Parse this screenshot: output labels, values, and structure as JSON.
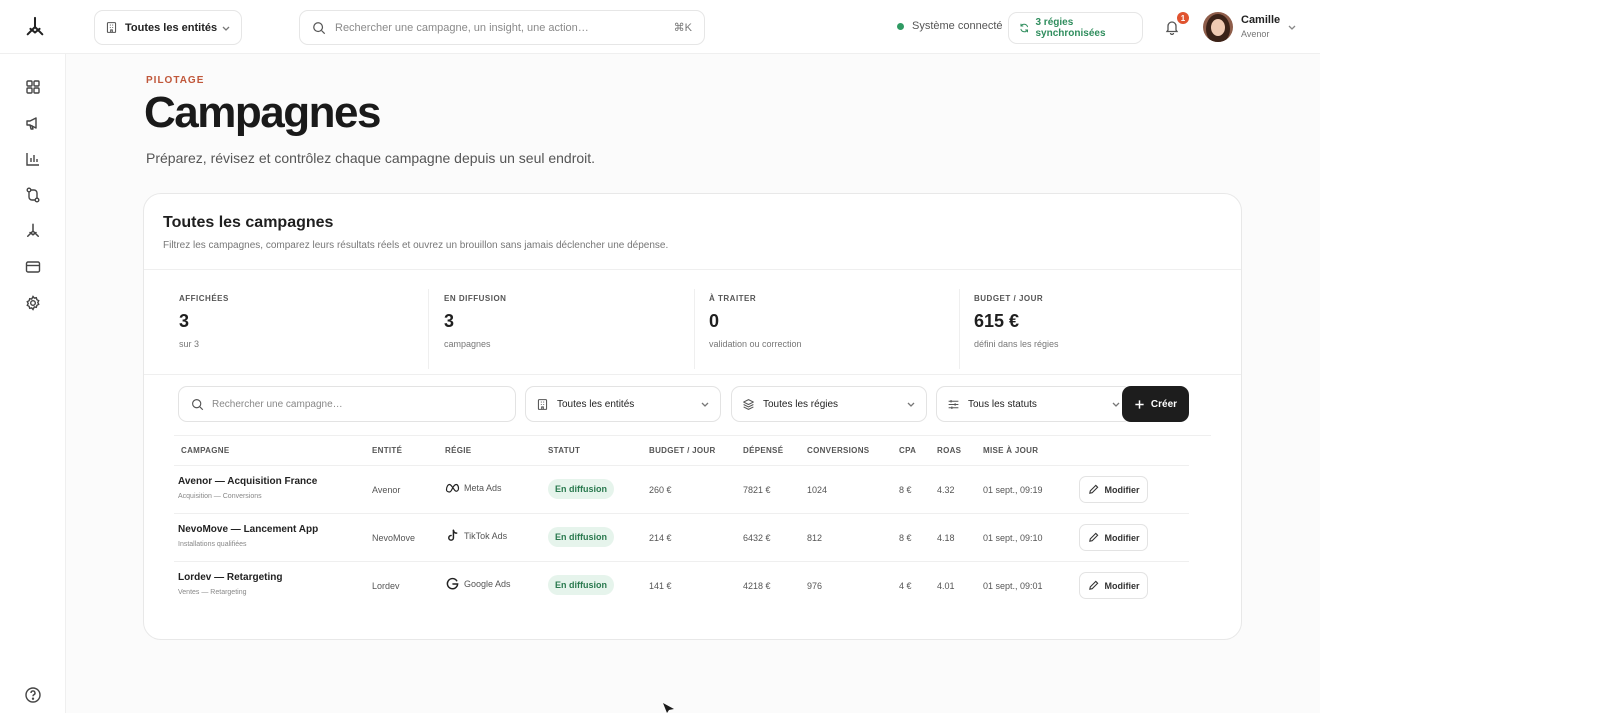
{
  "topbar": {
    "entity_select": "Toutes les entités",
    "search_placeholder": "Rechercher une campagne, un insight, une action…",
    "search_shortcut": "⌘K",
    "system_status": "Système connecté",
    "sync_label": "3 régies synchronisées",
    "notification_count": "1",
    "user_name": "Camille",
    "user_org": "Avenor"
  },
  "sidebar": {
    "icons": [
      "dashboard-icon",
      "megaphone-icon",
      "bar-chart-icon",
      "routes-icon",
      "brand-icon",
      "card-icon",
      "settings-icon"
    ],
    "help_icon": "help-icon"
  },
  "page": {
    "eyebrow": "PILOTAGE",
    "title": "Campagnes",
    "subtitle": "Préparez, révisez et contrôlez chaque campagne depuis un seul endroit."
  },
  "card": {
    "title": "Toutes les campagnes",
    "description": "Filtrez les campagnes, comparez leurs résultats réels et ouvrez un brouillon sans jamais déclencher une dépense.",
    "stats": [
      {
        "label": "AFFICHÉES",
        "value": "3",
        "note": "sur 3"
      },
      {
        "label": "EN DIFFUSION",
        "value": "3",
        "note": "campagnes"
      },
      {
        "label": "À TRAITER",
        "value": "0",
        "note": "validation ou correction"
      },
      {
        "label": "BUDGET / JOUR",
        "value": "615 €",
        "note": "défini dans les régies"
      }
    ],
    "filters": {
      "search_placeholder": "Rechercher une campagne…",
      "entity": "Toutes les entités",
      "regie": "Toutes les régies",
      "status": "Tous les statuts",
      "create_label": "Créer"
    },
    "table": {
      "headers": [
        "CAMPAGNE",
        "ENTITÉ",
        "RÉGIE",
        "STATUT",
        "BUDGET / JOUR",
        "DÉPENSÉ",
        "CONVERSIONS",
        "CPA",
        "ROAS",
        "MISE À JOUR"
      ],
      "rows": [
        {
          "name": "Avenor — Acquisition France",
          "sub": "Acquisition — Conversions",
          "entity": "Avenor",
          "regie": "Meta Ads",
          "regie_icon": "meta-icon",
          "status": "En diffusion",
          "budget": "260 €",
          "spent": "7821 €",
          "conversions": "1024",
          "cpa": "8 €",
          "roas": "4.32",
          "updated": "01 sept., 09:19",
          "action": "Modifier"
        },
        {
          "name": "NevoMove — Lancement App",
          "sub": "Installations qualifiées",
          "entity": "NevoMove",
          "regie": "TikTok Ads",
          "regie_icon": "tiktok-icon",
          "status": "En diffusion",
          "budget": "214 €",
          "spent": "6432 €",
          "conversions": "812",
          "cpa": "8 €",
          "roas": "4.18",
          "updated": "01 sept., 09:10",
          "action": "Modifier"
        },
        {
          "name": "Lordev — Retargeting",
          "sub": "Ventes — Retargeting",
          "entity": "Lordev",
          "regie": "Google Ads",
          "regie_icon": "google-icon",
          "status": "En diffusion",
          "budget": "141 €",
          "spent": "4218 €",
          "conversions": "976",
          "cpa": "4 €",
          "roas": "4.01",
          "updated": "01 sept., 09:01",
          "action": "Modifier"
        }
      ]
    }
  },
  "colors": {
    "accent": "#c0573a",
    "success": "#2f8d5d",
    "primary_button": "#1d1d1d"
  }
}
